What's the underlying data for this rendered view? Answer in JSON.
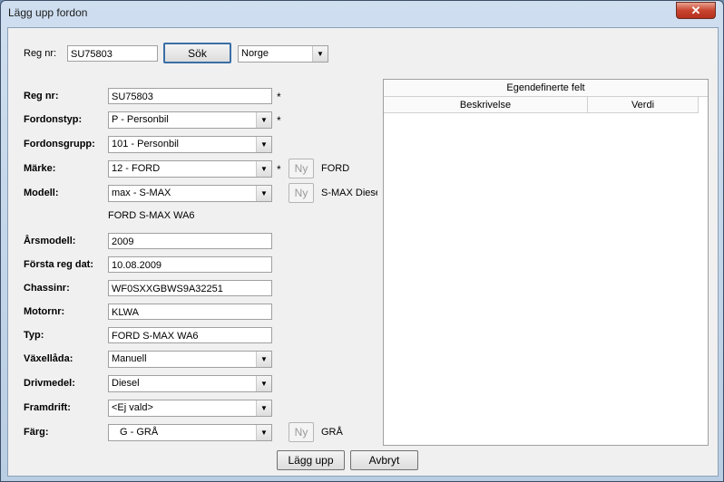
{
  "window": {
    "title": "Lägg upp fordon",
    "close_symbol": "✕"
  },
  "search": {
    "label": "Reg nr:",
    "value": "SU75803",
    "button": "Sök",
    "country": "Norge"
  },
  "form": {
    "regnr": {
      "label": "Reg nr:",
      "value": "SU75803",
      "required": "*"
    },
    "fordonstyp": {
      "label": "Fordonstyp:",
      "value": "P - Personbil",
      "required": "*"
    },
    "fordonsgrupp": {
      "label": "Fordonsgrupp:",
      "value": "101 - Personbil"
    },
    "marke": {
      "label": "Märke:",
      "value": "12 - FORD",
      "required": "*",
      "new_button": "Ny",
      "display": "FORD"
    },
    "modell": {
      "label": "Modell:",
      "value": "max - S-MAX",
      "new_button": "Ny",
      "display": "S-MAX Diese",
      "description": "FORD S-MAX WA6"
    },
    "arsmodell": {
      "label": "Årsmodell:",
      "value": "2009"
    },
    "forsta_reg": {
      "label": "Första reg dat:",
      "value": "10.08.2009"
    },
    "chassinr": {
      "label": "Chassinr:",
      "value": "WF0SXXGBWS9A32251"
    },
    "motornr": {
      "label": "Motornr:",
      "value": "KLWA"
    },
    "typ": {
      "label": "Typ:",
      "value": "FORD S-MAX WA6"
    },
    "vaxellada": {
      "label": "Växellåda:",
      "value": "Manuell"
    },
    "drivmedel": {
      "label": "Drivmedel:",
      "value": "Diesel"
    },
    "framdrift": {
      "label": "Framdrift:",
      "value": "<Ej vald>"
    },
    "farg": {
      "label": "Färg:",
      "value": "G - GRÅ",
      "new_button": "Ny",
      "display": "GRÅ"
    }
  },
  "custom_fields": {
    "title": "Egendefinerte felt",
    "columns": [
      "Beskrivelse",
      "Verdi"
    ]
  },
  "footer": {
    "save": "Lägg upp",
    "cancel": "Avbryt"
  }
}
